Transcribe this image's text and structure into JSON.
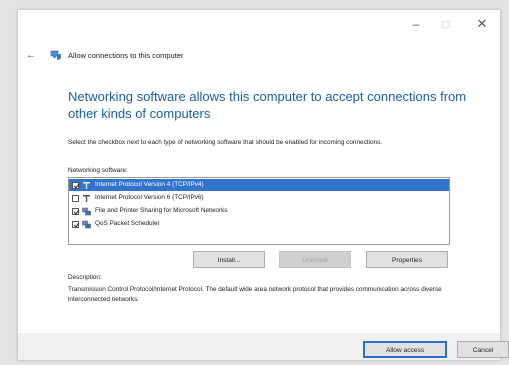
{
  "window": {
    "minimize_glyph": "–",
    "maximize_glyph": "□",
    "close_glyph": "✕"
  },
  "breadcrumb": {
    "back_glyph": "←",
    "icon": "network-shield-icon",
    "title": "Allow connections to this computer"
  },
  "main": {
    "heading": "Networking software allows this computer to accept connections from other kinds of computers",
    "instruction": "Select the checkbox next to each type of networking software that should be enabled for incoming connections.",
    "list_label": "Networking software:",
    "items": [
      {
        "label": "Internet Protocol Version 4 (TCP/IPv4)",
        "checked": true,
        "selected": true,
        "icon": "protocol-icon"
      },
      {
        "label": "Internet Protocol Version 6 (TCP/IPv6)",
        "checked": false,
        "selected": false,
        "icon": "protocol-icon"
      },
      {
        "label": "File and Printer Sharing for Microsoft Networks",
        "checked": true,
        "selected": false,
        "icon": "network-service-icon"
      },
      {
        "label": "QoS Packet Scheduler",
        "checked": true,
        "selected": false,
        "icon": "network-service-icon"
      }
    ],
    "buttons": {
      "install": "Install...",
      "uninstall": "Uninstall",
      "properties": "Properties"
    },
    "description_label": "Description:",
    "description_text": "Transmission Control Protocol/Internet Protocol. The default wide area network protocol that provides communication across diverse interconnected networks."
  },
  "footer": {
    "allow": "Allow access",
    "cancel": "Cancel"
  },
  "colors": {
    "heading": "#1b5fa8",
    "selection": "#3274cc",
    "default_button_border": "#2a72c9"
  }
}
